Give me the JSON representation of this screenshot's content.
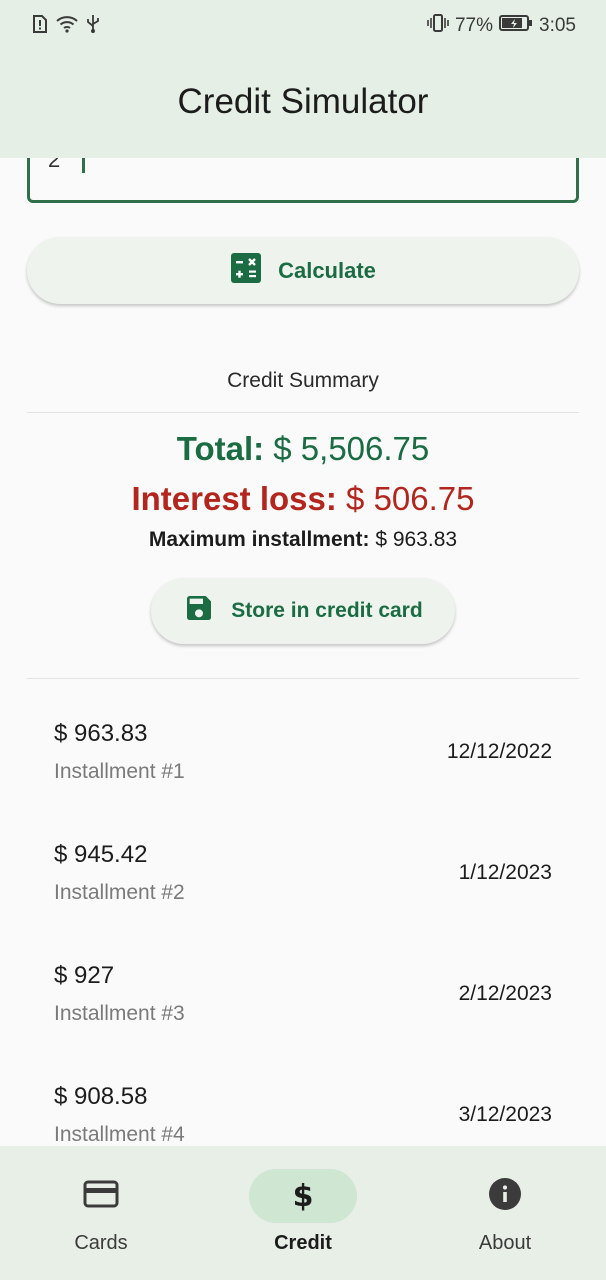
{
  "status_bar": {
    "battery_percent": "77%",
    "time": "3:05",
    "icons": [
      "alert-icon",
      "wifi-icon",
      "usb-icon",
      "vibrate-icon",
      "battery-icon"
    ]
  },
  "app": {
    "title": "Credit Simulator"
  },
  "form": {
    "partial_value": "2"
  },
  "calculate_button": {
    "label": "Calculate",
    "icon": "calculator-icon"
  },
  "summary": {
    "title": "Credit Summary",
    "total_label": "Total:",
    "total_value": "$ 5,506.75",
    "interest_label": "Interest loss:",
    "interest_value": "$ 506.75",
    "max_label": "Maximum installment:",
    "max_value": "$ 963.83"
  },
  "store_button": {
    "label": "Store in credit card",
    "icon": "save-icon"
  },
  "installments": [
    {
      "amount": "$ 963.83",
      "label": "Installment #1",
      "date": "12/12/2022"
    },
    {
      "amount": "$ 945.42",
      "label": "Installment #2",
      "date": "1/12/2023"
    },
    {
      "amount": "$ 927",
      "label": "Installment #3",
      "date": "2/12/2023"
    },
    {
      "amount": "$ 908.58",
      "label": "Installment #4",
      "date": "3/12/2023"
    }
  ],
  "nav": {
    "items": [
      {
        "label": "Cards",
        "icon": "credit-card-icon"
      },
      {
        "label": "Credit",
        "icon": "dollar-icon"
      },
      {
        "label": "About",
        "icon": "info-icon"
      }
    ],
    "active": "Credit"
  },
  "colors": {
    "accent": "#1b6b43",
    "loss": "#b3261e",
    "appbar": "#e5efe5"
  }
}
